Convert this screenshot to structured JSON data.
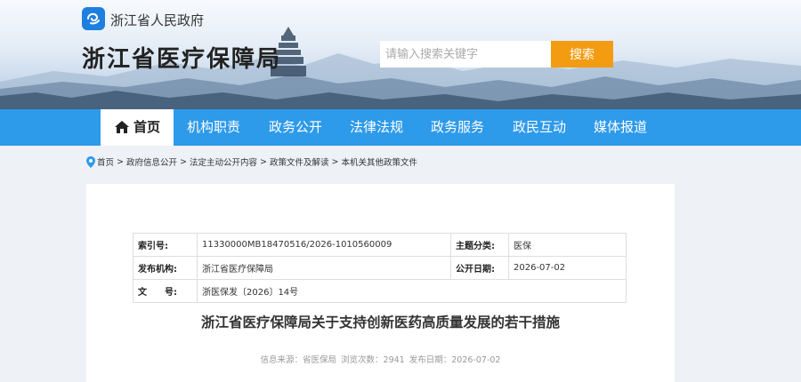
{
  "header": {
    "gov_name": "浙江省人民政府",
    "site_title": "浙江省医疗保障局",
    "search": {
      "placeholder": "请输入搜索关键字",
      "button_label": "搜索"
    }
  },
  "nav": {
    "items": [
      {
        "label": "首页",
        "active": true
      },
      {
        "label": "机构职责"
      },
      {
        "label": "政务公开"
      },
      {
        "label": "法律法规"
      },
      {
        "label": "政务服务"
      },
      {
        "label": "政民互动"
      },
      {
        "label": "媒体报道"
      }
    ]
  },
  "breadcrumb": [
    "首页",
    "政府信息公开",
    "法定主动公开内容",
    "政策文件及解读",
    "本机关其他政策文件"
  ],
  "meta": {
    "index_no_label": "索引号:",
    "index_no": "11330000MB18470516/2026-1010560009",
    "topic_label": "主题分类:",
    "topic": "医保",
    "publisher_label": "发布机构:",
    "publisher": "浙江省医疗保障局",
    "date_label": "公开日期:",
    "date": "2026-07-02",
    "doc_no_label": "文　　号:",
    "doc_no": "浙医保发〔2026〕14号"
  },
  "document": {
    "title": "浙江省医疗保障局关于支持创新医药高质量发展的若干措施",
    "source": "信息来源：省医保局",
    "views": "浏览次数：2941",
    "publish_date": "发布日期：2026-07-02"
  },
  "colors": {
    "nav_bg": "#2e9aea",
    "search_btn": "#f39c12",
    "logo": "#1d7fe0"
  }
}
